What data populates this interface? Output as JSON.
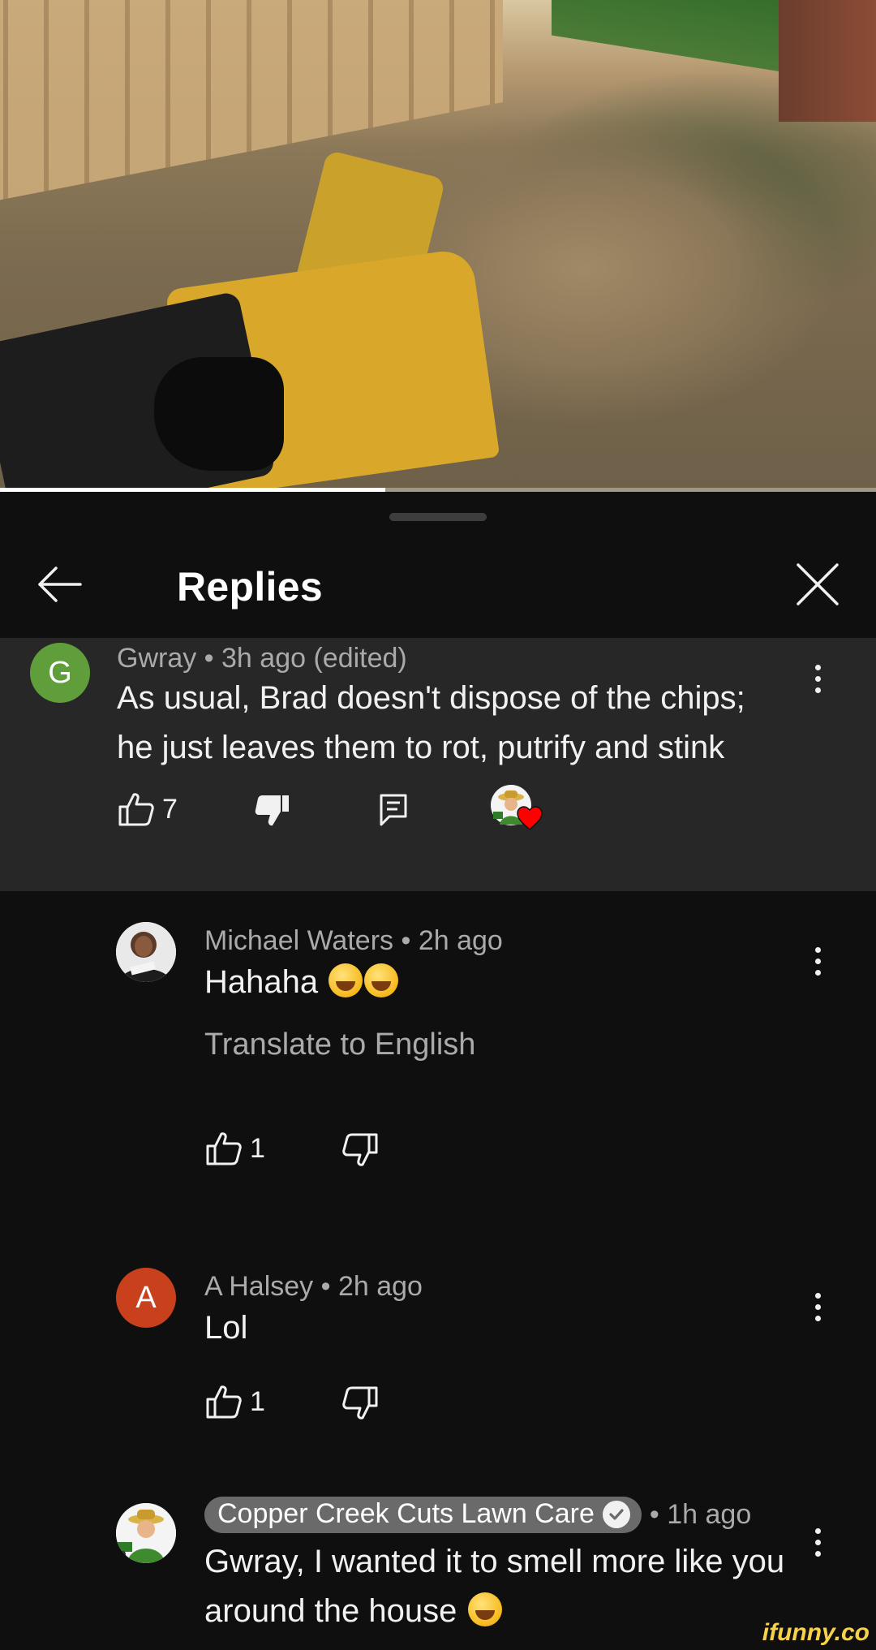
{
  "video": {
    "progress": 0.44
  },
  "sheet": {
    "title": "Replies"
  },
  "parent_comment": {
    "avatar_letter": "G",
    "avatar_color": "#5f9e3a",
    "meta": "Gwray • 3h ago (edited)",
    "text_line1": "As usual, Brad doesn't dispose of the chips;",
    "text_line2": "he just leaves them to rot, putrify and stink",
    "likes": "7"
  },
  "replies": [
    {
      "meta": "Michael Waters • 2h ago",
      "text": "Hahaha",
      "translate": "Translate to English",
      "likes": "1"
    },
    {
      "avatar_letter": "A",
      "avatar_color": "#c9401d",
      "meta": "A Halsey • 2h ago",
      "text": "Lol",
      "likes": "1"
    },
    {
      "channel": "Copper Creek Cuts Lawn Care",
      "time": "• 1h ago",
      "text_line1": "Gwray, I wanted it to smell more like you",
      "text_line2": "around the house"
    }
  ],
  "watermark": "ifunny.co",
  "icons": [
    "back-arrow-icon",
    "close-icon",
    "thumbs-up-icon",
    "thumbs-down-icon",
    "reply-icon",
    "heart-icon",
    "more-vert-icon",
    "verified-check-icon"
  ]
}
